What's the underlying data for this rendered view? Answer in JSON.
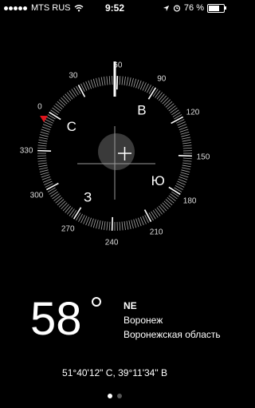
{
  "status_bar": {
    "carrier": "MTS RUS",
    "time": "9:52",
    "battery": "76 %"
  },
  "compass": {
    "degree_labels": [
      "0",
      "30",
      "60",
      "90",
      "120",
      "150",
      "180",
      "210",
      "240",
      "270",
      "300",
      "330"
    ],
    "cardinals": [
      {
        "label": "С",
        "angle": 0
      },
      {
        "label": "В",
        "angle": 90
      },
      {
        "label": "Ю",
        "angle": 180
      },
      {
        "label": "З",
        "angle": 270
      }
    ],
    "heading_deg": 58,
    "north_marker_color": "#e0151d",
    "accent": "#ffffff"
  },
  "readout": {
    "heading": "58",
    "direction": "NE",
    "city": "Воронеж",
    "region": "Воронежская область"
  },
  "coordinates": "51°40'12\" С, 39°11'34\" В",
  "pager": {
    "pages": 2,
    "active": 0
  }
}
